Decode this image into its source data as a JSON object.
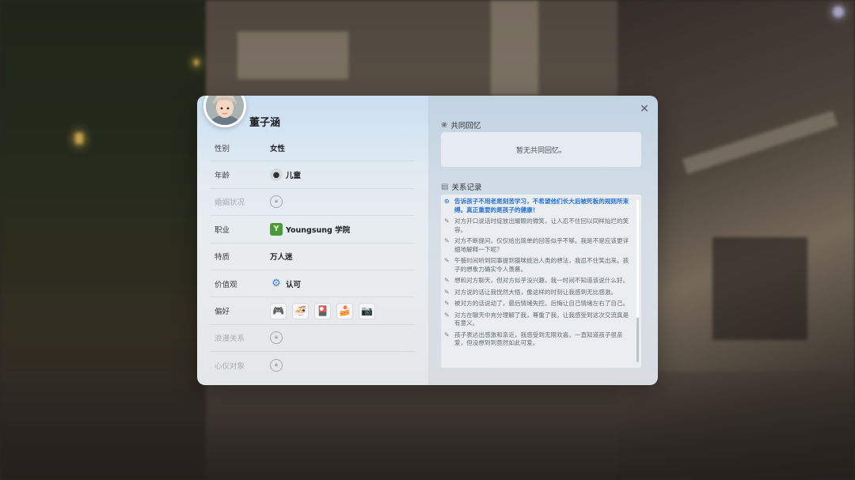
{
  "character": {
    "name": "董子涵"
  },
  "profile": [
    {
      "label": "性别",
      "value": "女性",
      "icon": "",
      "locked": false
    },
    {
      "label": "年龄",
      "value": "儿童",
      "icon": "child-icon",
      "locked": false
    },
    {
      "label": "婚姻状况",
      "value": "",
      "icon": "lock-icon",
      "locked": true
    },
    {
      "label": "职业",
      "value": "Youngsung 学院",
      "icon": "school-logo-icon",
      "locked": false
    },
    {
      "label": "特质",
      "value": "万人迷",
      "icon": "",
      "locked": false
    },
    {
      "label": "价值观",
      "value": "认可",
      "icon": "gear-icon",
      "locked": false
    },
    {
      "label": "偏好",
      "value": "",
      "icon": "",
      "locked": false
    },
    {
      "label": "浪漫关系",
      "value": "",
      "icon": "lock-icon",
      "locked": true
    },
    {
      "label": "心仪对象",
      "value": "",
      "icon": "lock-icon",
      "locked": true
    }
  ],
  "hobbies": [
    {
      "name": "game-controller-icon",
      "glyph": "🎮"
    },
    {
      "name": "bowl-icon",
      "glyph": "🍜"
    },
    {
      "name": "card-icon",
      "glyph": "🎴"
    },
    {
      "name": "baking-icon",
      "glyph": "🍰"
    },
    {
      "name": "camera-icon",
      "glyph": "📷"
    }
  ],
  "memories": {
    "title": "共同回忆",
    "empty_text": "暂无共同回忆。"
  },
  "relationship_log": {
    "title": "关系记录",
    "entries": [
      {
        "text": "告诉孩子不用老是刻苦学习，不希望他们长大后被死板的规则所束缚。真正重要的是孩子的健康！",
        "highlight": true
      },
      {
        "text": "对方开口说话时绽放出耀眼的微笑，让人忍不住回以同样灿烂的笑容。",
        "highlight": false
      },
      {
        "text": "对方不断提问，仅仅给出简单的回答似乎不够。我是不是应该更详细地解释一下呢？",
        "highlight": false
      },
      {
        "text": "午餐时间听到同事提到猫咪统治人类的想法，我忍不住笑出来。孩子的想象力确实令人羡慕。",
        "highlight": false
      },
      {
        "text": "想和对方聊天，但对方似乎没兴趣，我一时间不知道该说什么好。",
        "highlight": false
      },
      {
        "text": "对方说的话让我恍然大悟，像这样的时刻让我感到无比感激。",
        "highlight": false
      },
      {
        "text": "被对方的话说动了，最后情绪失控。后悔让自己情绪左右了自己。",
        "highlight": false
      },
      {
        "text": "对方在聊天中充分理解了我，尊重了我，让我感受到这次交流真是有意义。",
        "highlight": false
      },
      {
        "text": "孩子表达出感激和亲近，我感受到无限欢喜。一直知道孩子很亲爱，但没想到到竟然如此可爱。",
        "highlight": false
      }
    ]
  }
}
